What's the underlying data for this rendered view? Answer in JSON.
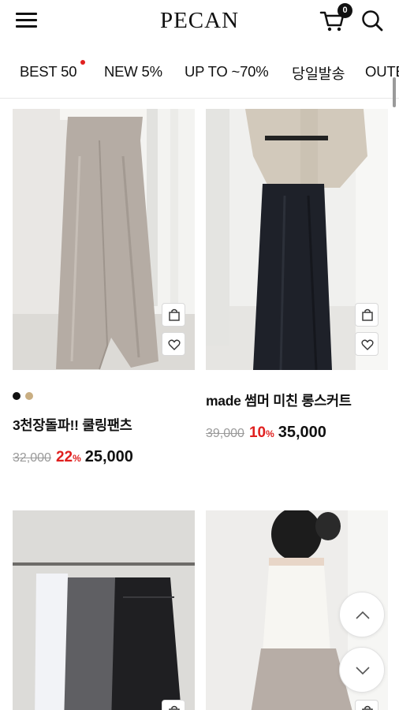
{
  "header": {
    "logo": "PECAN",
    "cart_count": "0",
    "menu_icon": "hamburger-menu-icon",
    "cart_icon": "shopping-cart-icon",
    "search_icon": "search-icon"
  },
  "tabs": [
    {
      "label": "BEST 50",
      "has_dot": true
    },
    {
      "label": "NEW 5%"
    },
    {
      "label": "UP TO ~70%"
    },
    {
      "label": "당일발송"
    },
    {
      "label": "OUTER"
    }
  ],
  "products": [
    {
      "name": "3천장돌파!! 쿨링팬츠",
      "original_price": "32,000",
      "discount": "22",
      "discount_unit": "%",
      "price": "25,000",
      "swatches": [
        "#111111",
        "#c9ae82"
      ]
    },
    {
      "name": "made 썸머 미친 롱스커트",
      "original_price": "39,000",
      "discount": "10",
      "discount_unit": "%",
      "price": "35,000",
      "swatches": []
    },
    {
      "name": "",
      "original_price": "",
      "discount": "",
      "price": ""
    },
    {
      "name": "",
      "original_price": "",
      "discount": "",
      "price": ""
    }
  ],
  "floating": {
    "up_icon": "chevron-up-icon",
    "down_icon": "chevron-down-icon"
  },
  "colors": {
    "accent_red": "#e0201f",
    "text": "#111111",
    "muted": "#9a9a9a"
  }
}
